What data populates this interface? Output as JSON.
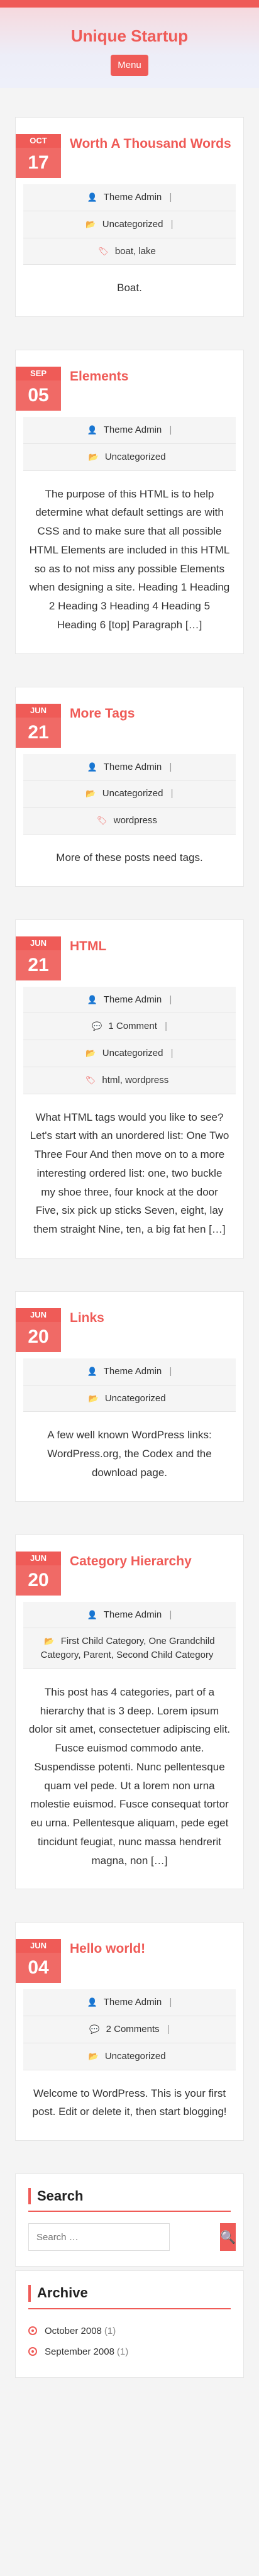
{
  "site": {
    "title": "Unique Startup",
    "menu_label": "Menu"
  },
  "posts": [
    {
      "month": "OCT",
      "day": "17",
      "title": "Worth A Thousand Words",
      "meta": [
        {
          "icon": "user-icon",
          "text": "Theme Admin",
          "sep": "|"
        },
        {
          "icon": "folder-icon",
          "text": "Uncategorized",
          "sep": "|"
        },
        {
          "icon": "tag-icon",
          "text": "boat, lake",
          "sep": ""
        }
      ],
      "excerpt": "Boat."
    },
    {
      "month": "SEP",
      "day": "05",
      "title": "Elements",
      "meta": [
        {
          "icon": "user-icon",
          "text": "Theme Admin",
          "sep": "|"
        },
        {
          "icon": "folder-icon",
          "text": "Uncategorized",
          "sep": ""
        }
      ],
      "excerpt": "The purpose of this HTML is to help determine what default settings are with CSS and to make sure that all possible HTML Elements are included in this HTML so as to not miss any possible Elements when designing a site. Heading 1 Heading 2 Heading 3 Heading 4 Heading 5 Heading 6 [top] Paragraph […]"
    },
    {
      "month": "JUN",
      "day": "21",
      "title": "More Tags",
      "meta": [
        {
          "icon": "user-icon",
          "text": "Theme Admin",
          "sep": "|"
        },
        {
          "icon": "folder-icon",
          "text": "Uncategorized",
          "sep": "|"
        },
        {
          "icon": "tag-icon",
          "text": "wordpress",
          "sep": ""
        }
      ],
      "excerpt": "More of these posts need tags."
    },
    {
      "month": "JUN",
      "day": "21",
      "title": "HTML",
      "meta": [
        {
          "icon": "user-icon",
          "text": "Theme Admin",
          "sep": "|"
        },
        {
          "icon": "comment-icon",
          "text": "1 Comment",
          "sep": "|"
        },
        {
          "icon": "folder-icon",
          "text": "Uncategorized",
          "sep": "|"
        },
        {
          "icon": "tag-icon",
          "text": "html, wordpress",
          "sep": ""
        }
      ],
      "excerpt": "What HTML tags would you like to see? Let's start with an unordered list: One Two Three Four And then move on to a more interesting ordered list: one, two buckle my shoe three, four knock at the door Five, six pick up sticks Seven, eight, lay them straight Nine, ten, a big fat hen […]"
    },
    {
      "month": "JUN",
      "day": "20",
      "title": "Links",
      "meta": [
        {
          "icon": "user-icon",
          "text": "Theme Admin",
          "sep": "|"
        },
        {
          "icon": "folder-icon",
          "text": "Uncategorized",
          "sep": ""
        }
      ],
      "excerpt": "A few well known WordPress links: WordPress.org, the Codex and the download page."
    },
    {
      "month": "JUN",
      "day": "20",
      "title": "Category Hierarchy",
      "meta": [
        {
          "icon": "user-icon",
          "text": "Theme Admin",
          "sep": "|"
        },
        {
          "icon": "folder-icon",
          "text": "First Child Category,  One Grandchild Category,  Parent,  Second Child Category",
          "sep": ""
        }
      ],
      "excerpt": "This post has 4 categories, part of a hierarchy that is 3 deep. Lorem ipsum dolor sit amet, consectetuer adipiscing elit. Fusce euismod commodo ante. Suspendisse potenti. Nunc pellentesque quam vel pede. Ut a lorem non urna molestie euismod. Fusce consequat tortor eu urna. Pellentesque aliquam, pede eget tincidunt feugiat, nunc massa hendrerit magna, non […]"
    },
    {
      "month": "JUN",
      "day": "04",
      "title": "Hello world!",
      "meta": [
        {
          "icon": "user-icon",
          "text": "Theme Admin",
          "sep": "|"
        },
        {
          "icon": "comment-icon",
          "text": "2 Comments",
          "sep": "|"
        },
        {
          "icon": "folder-icon",
          "text": "Uncategorized",
          "sep": ""
        }
      ],
      "excerpt": "Welcome to WordPress. This is your first post. Edit or delete it, then start blogging!"
    }
  ],
  "search": {
    "title": "Search",
    "placeholder": "Search …"
  },
  "archive": {
    "title": "Archive",
    "items": [
      {
        "label": "October 2008",
        "count": "(1)"
      },
      {
        "label": "September 2008",
        "count": "(1)"
      }
    ]
  },
  "icons": {
    "user-icon": "👤",
    "folder-icon": "📂",
    "tag-icon": "🏷",
    "comment-icon": "💬",
    "search-icon": "🔍"
  },
  "colors": {
    "accent": "#ef5b57"
  }
}
